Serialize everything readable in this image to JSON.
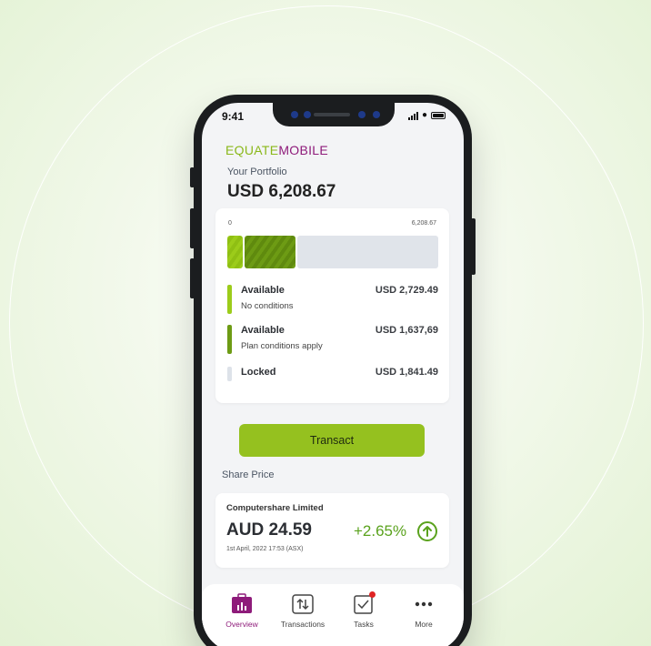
{
  "device": {
    "status_time": "9:41"
  },
  "header": {
    "logo_part1": "EQUATE",
    "logo_part2": "MOBILE",
    "portfolio_label": "Your Portfolio",
    "portfolio_value": "USD 6,208.67"
  },
  "portfolio_card": {
    "scale_min": "0",
    "scale_max": "6,208.67",
    "segments": [
      {
        "name": "Available - No conditions",
        "value": 2729.49,
        "color": "#9ccc1a"
      },
      {
        "name": "Available - Plan conditions apply",
        "value": 1637.69,
        "color": "#6d9b14"
      },
      {
        "name": "Locked",
        "value": 1841.49,
        "color": "#e0e4ea"
      }
    ],
    "rows": [
      {
        "title": "Available",
        "subtitle": "No conditions",
        "amount": "USD 2,729.49",
        "color": "#9ccc1a"
      },
      {
        "title": "Available",
        "subtitle": "Plan conditions apply",
        "amount": "USD 1,637,69",
        "color": "#6d9b14"
      },
      {
        "title": "Locked",
        "subtitle": "",
        "amount": "USD 1,841.49",
        "color": "#e0e4ea"
      }
    ]
  },
  "actions": {
    "transact_label": "Transact"
  },
  "share": {
    "section_label": "Share Price",
    "company": "Computershare Limited",
    "price": "AUD 24.59",
    "change": "+2.65%",
    "date": "1st April, 2022 17:53 (ASX)",
    "change_color": "#5aa21d"
  },
  "nav": {
    "items": [
      {
        "label": "Overview",
        "icon": "overview-icon",
        "active": true
      },
      {
        "label": "Transactions",
        "icon": "transactions-icon",
        "active": false
      },
      {
        "label": "Tasks",
        "icon": "tasks-icon",
        "active": false,
        "badge": true
      },
      {
        "label": "More",
        "icon": "more-icon",
        "active": false
      }
    ]
  },
  "colors": {
    "accent_green": "#95c11f",
    "brand_purple": "#8e1b7a",
    "positive_green": "#5aa21d"
  }
}
